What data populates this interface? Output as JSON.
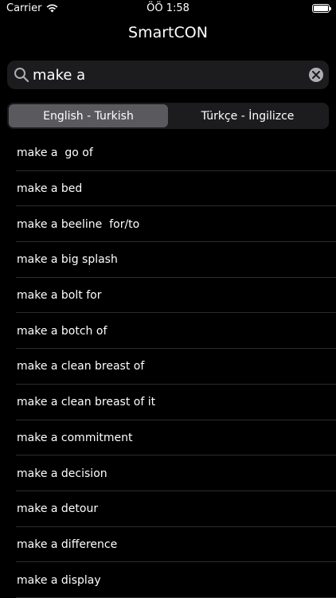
{
  "status_bar": {
    "carrier": "Carrier",
    "time": "ÖÖ 1:58"
  },
  "nav": {
    "title": "SmartCON"
  },
  "search": {
    "value": "make a"
  },
  "segments": [
    {
      "label": "English - Turkish",
      "selected": true
    },
    {
      "label": "Türkçe - İngilizce",
      "selected": false
    }
  ],
  "results": [
    "make a  go of",
    "make a bed",
    "make a beeline  for/to",
    "make a big splash",
    "make a bolt for",
    "make a botch of",
    "make a clean breast of",
    "make a clean breast of it",
    "make a commitment",
    "make a decision",
    "make a detour",
    "make a difference",
    "make a display"
  ],
  "colors": {
    "background": "#000000",
    "field": "#1c1c1e",
    "selected_segment": "#5a5a5e",
    "separator": "#2c2c2e"
  }
}
